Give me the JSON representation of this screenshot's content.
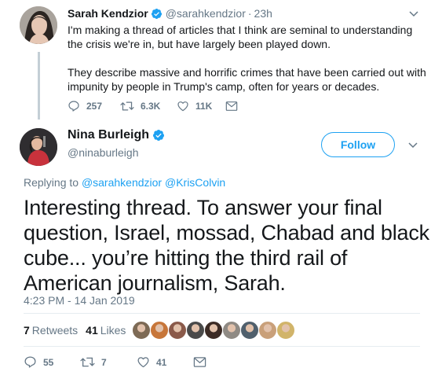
{
  "parent_tweet": {
    "name": "Sarah Kendzior",
    "handle": "@sarahkendzior",
    "separator": "·",
    "time": "23h",
    "text_p1": "I'm making a thread of articles that I think are seminal to understanding the crisis we're in, but have largely been played down.",
    "text_p2": "They describe massive and horrific crimes that have been carried out with impunity by people in Trump's camp, often for years or decades.",
    "replies": "257",
    "retweets": "6.3K",
    "likes": "11K"
  },
  "main_tweet": {
    "name": "Nina Burleigh",
    "handle": "@ninaburleigh",
    "follow_label": "Follow",
    "replying_prefix": "Replying to",
    "mention_1": "@sarahkendzior",
    "mention_2": "@KrisColvin",
    "text": "Interesting thread. To answer your final question, Israel, mossad, Chabad and black cube... you’re hitting the third rail of American journalism, Sarah.",
    "timestamp": "4:23 PM - 14 Jan 2019",
    "retweets_count": "7",
    "retweets_label": "Retweets",
    "likes_count": "41",
    "likes_label": "Likes",
    "reply_count": "55",
    "retweet_count": "7",
    "like_count": "41"
  },
  "colors": {
    "accent": "#1da1f2",
    "muted": "#657786",
    "text": "#14171a",
    "thread_line": "#c4cfd6"
  },
  "liker_avatar_colors": [
    "#7d6a55",
    "#c7763a",
    "#8a5a4a",
    "#4a4a4a",
    "#3c2b25",
    "#8f8a84",
    "#50606d",
    "#c9a07a",
    "#d1b46a"
  ]
}
